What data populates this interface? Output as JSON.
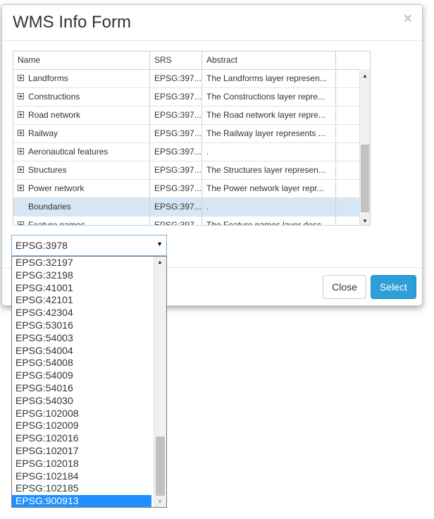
{
  "dialog": {
    "title": "WMS Info Form",
    "close_glyph": "×"
  },
  "grid": {
    "columns": [
      "Name",
      "SRS",
      "Abstract"
    ],
    "rows": [
      {
        "name": "Landforms",
        "srs": "EPSG:397...",
        "abstract": "The Landforms layer represen...",
        "expandable": true,
        "selected": false
      },
      {
        "name": "Constructions",
        "srs": "EPSG:397...",
        "abstract": "The Constructions layer repre...",
        "expandable": true,
        "selected": false
      },
      {
        "name": "Road network",
        "srs": "EPSG:397...",
        "abstract": "The Road network layer repre...",
        "expandable": true,
        "selected": false
      },
      {
        "name": "Railway",
        "srs": "EPSG:397...",
        "abstract": "The Railway layer represents ...",
        "expandable": true,
        "selected": false
      },
      {
        "name": "Aeronautical features",
        "srs": "EPSG:397...",
        "abstract": ".",
        "expandable": true,
        "selected": false
      },
      {
        "name": "Structures",
        "srs": "EPSG:397...",
        "abstract": "The Structures layer represen...",
        "expandable": true,
        "selected": false
      },
      {
        "name": "Power network",
        "srs": "EPSG:397...",
        "abstract": "The Power network layer repr...",
        "expandable": true,
        "selected": false
      },
      {
        "name": "Boundaries",
        "srs": "EPSG:397...",
        "abstract": ".",
        "expandable": false,
        "selected": true
      },
      {
        "name": "Feature names",
        "srs": "EPSG:397...",
        "abstract": "The Feature names layer desc...",
        "expandable": true,
        "selected": false
      }
    ],
    "selected_row_color": "#d6e6f5"
  },
  "srs_select": {
    "value": "EPSG:3978",
    "options": [
      "EPSG:32197",
      "EPSG:32198",
      "EPSG:41001",
      "EPSG:42101",
      "EPSG:42304",
      "EPSG:53016",
      "EPSG:54003",
      "EPSG:54004",
      "EPSG:54008",
      "EPSG:54009",
      "EPSG:54016",
      "EPSG:54030",
      "EPSG:102008",
      "EPSG:102009",
      "EPSG:102016",
      "EPSG:102017",
      "EPSG:102018",
      "EPSG:102184",
      "EPSG:102185",
      "EPSG:900913"
    ],
    "highlighted": "EPSG:900913",
    "highlight_color": "#1e90ff"
  },
  "footer": {
    "close_label": "Close",
    "select_label": "Select",
    "accent_color": "#2d9fd8"
  }
}
